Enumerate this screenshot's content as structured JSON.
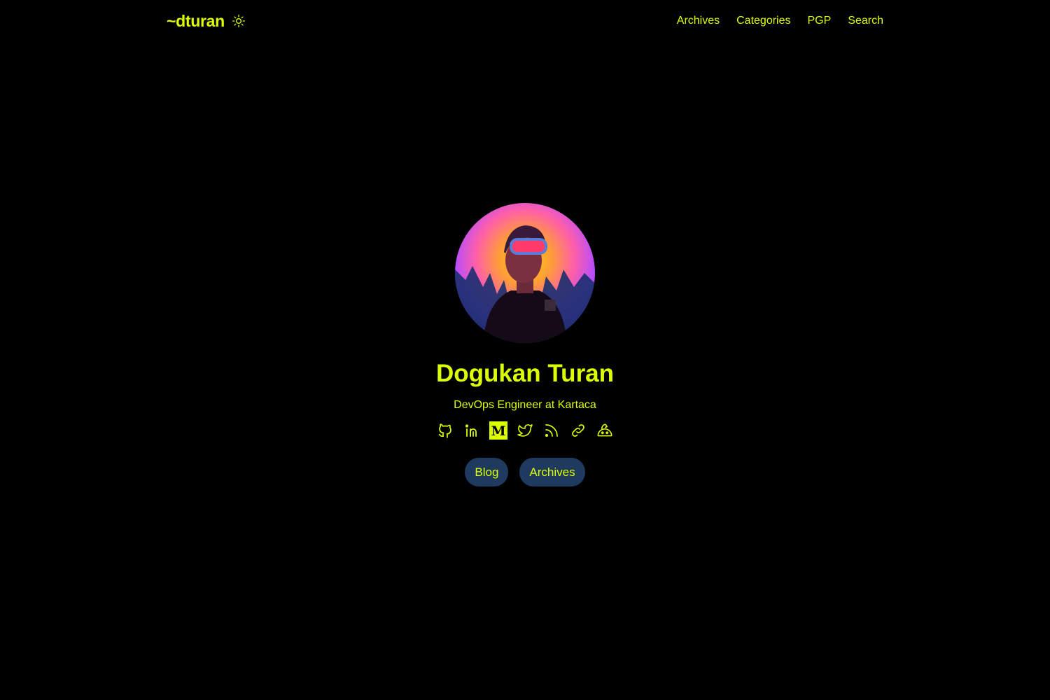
{
  "header": {
    "logo": "~dturan",
    "nav": [
      "Archives",
      "Categories",
      "PGP",
      "Search"
    ]
  },
  "profile": {
    "name": "Dogukan Turan",
    "tagline": "DevOps Engineer at Kartaca"
  },
  "socials": [
    {
      "icon": "github-icon"
    },
    {
      "icon": "linkedin-icon"
    },
    {
      "icon": "medium-icon",
      "label": "M"
    },
    {
      "icon": "twitter-icon"
    },
    {
      "icon": "rss-icon"
    },
    {
      "icon": "link-icon"
    },
    {
      "icon": "kofi-icon"
    }
  ],
  "buttons": {
    "blog": "Blog",
    "archives": "Archives"
  },
  "colors": {
    "accent": "#dbff00",
    "background": "#000000",
    "button_bg": "#1e3a5f"
  }
}
